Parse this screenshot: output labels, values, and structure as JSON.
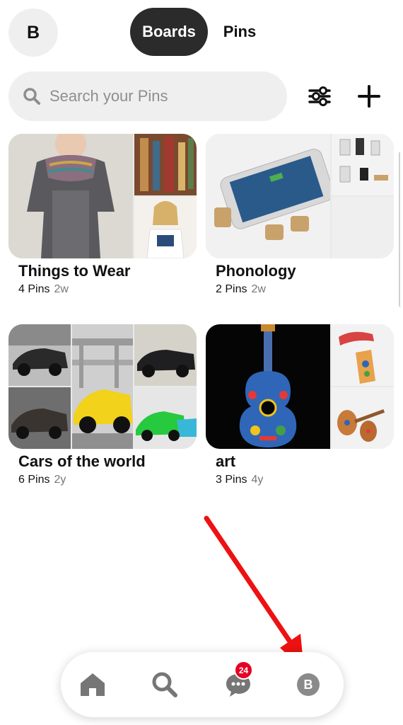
{
  "header": {
    "avatar_letter": "B",
    "tabs": [
      {
        "label": "Boards",
        "active": true
      },
      {
        "label": "Pins",
        "active": false
      }
    ]
  },
  "search": {
    "placeholder": "Search your Pins",
    "value": ""
  },
  "toolbar": {
    "filter_icon": "sliders-icon",
    "add_icon": "plus-icon"
  },
  "boards": [
    {
      "title": "Things to Wear",
      "pin_count": "4 Pins",
      "age": "2w"
    },
    {
      "title": "Phonology",
      "pin_count": "2 Pins",
      "age": "2w"
    },
    {
      "title": "Cars of the world",
      "pin_count": "6 Pins",
      "age": "2y"
    },
    {
      "title": "art",
      "pin_count": "3 Pins",
      "age": "4y"
    }
  ],
  "bottom_nav": {
    "items": [
      {
        "icon": "home-icon"
      },
      {
        "icon": "search-icon"
      },
      {
        "icon": "messages-icon",
        "badge": "24"
      },
      {
        "icon": "profile-icon",
        "letter": "B"
      }
    ]
  },
  "colors": {
    "active_tab": "#2b2b2b",
    "search_bg": "#efefef",
    "badge": "#e60023",
    "annotation_arrow": "#ee1111"
  }
}
